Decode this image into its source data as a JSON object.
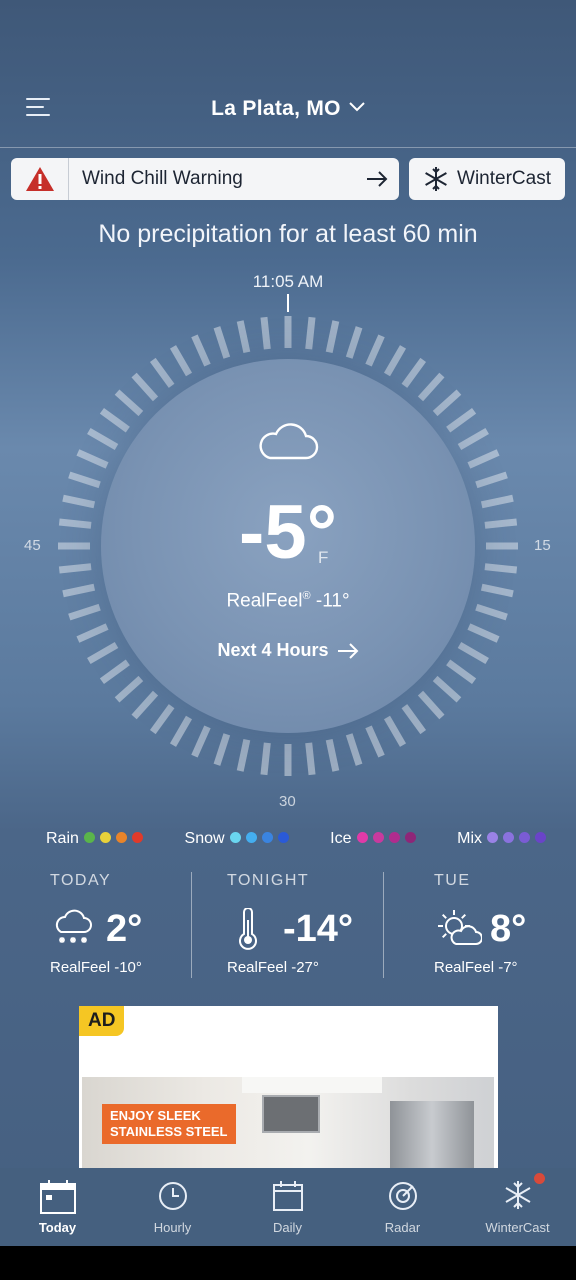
{
  "header": {
    "location": "La Plata, MO"
  },
  "alert": {
    "text": "Wind Chill Warning",
    "button": "WinterCast"
  },
  "precip_message": "No precipitation for at least 60 min",
  "dial": {
    "time": "11:05 AM",
    "left_label": "45",
    "right_label": "15",
    "bottom_label": "30"
  },
  "current": {
    "temp": "-5°",
    "unit": "F",
    "realfeel_prefix": "RealFeel",
    "realfeel_reg": "®",
    "realfeel_value": " -11°",
    "next_hours": "Next 4 Hours",
    "condition_icon": "cloud-icon"
  },
  "legend": [
    {
      "label": "Rain",
      "colors": [
        "#5ab54a",
        "#e8d23a",
        "#e8842a",
        "#e03a2a"
      ]
    },
    {
      "label": "Snow",
      "colors": [
        "#6ad6f0",
        "#44aef0",
        "#3a84e0",
        "#2a5ad8"
      ]
    },
    {
      "label": "Ice",
      "colors": [
        "#e03aa8",
        "#c83a9e",
        "#b02c8e",
        "#8e2678"
      ]
    },
    {
      "label": "Mix",
      "colors": [
        "#9a82e6",
        "#8a72de",
        "#7a5cd4",
        "#6a44c8"
      ]
    }
  ],
  "forecast": [
    {
      "label": "TODAY",
      "temp": "2°",
      "realfeel": "RealFeel -10°",
      "icon": "snow-cloud-icon"
    },
    {
      "label": "TONIGHT",
      "temp": "-14°",
      "realfeel": "RealFeel -27°",
      "icon": "thermometer-icon"
    },
    {
      "label": "TUE",
      "temp": "8°",
      "realfeel": "RealFeel -7°",
      "icon": "partly-sunny-icon"
    }
  ],
  "ad": {
    "badge": "AD",
    "headline_1": "ENJOY SLEEK",
    "headline_2": "STAINLESS STEEL"
  },
  "nav": [
    {
      "label": "Today",
      "active": true
    },
    {
      "label": "Hourly"
    },
    {
      "label": "Daily"
    },
    {
      "label": "Radar"
    },
    {
      "label": "WinterCast"
    }
  ]
}
